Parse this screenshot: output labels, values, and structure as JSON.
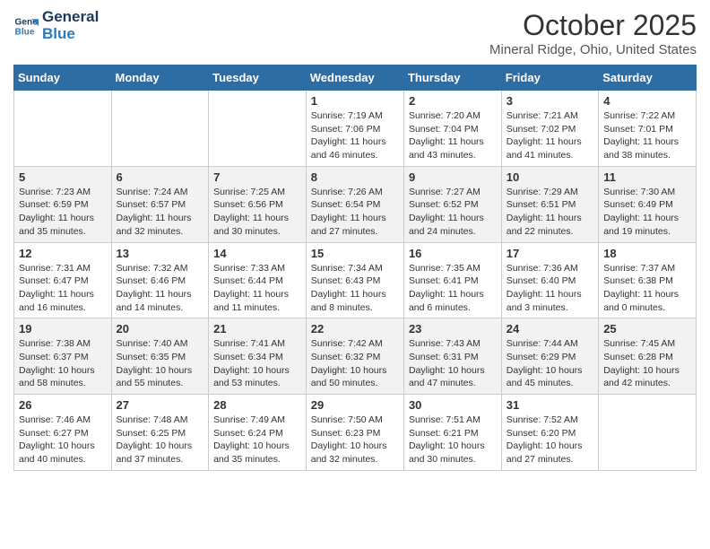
{
  "header": {
    "logo_line1": "General",
    "logo_line2": "Blue",
    "month_title": "October 2025",
    "location": "Mineral Ridge, Ohio, United States"
  },
  "weekdays": [
    "Sunday",
    "Monday",
    "Tuesday",
    "Wednesday",
    "Thursday",
    "Friday",
    "Saturday"
  ],
  "weeks": [
    [
      {
        "day": "",
        "info": ""
      },
      {
        "day": "",
        "info": ""
      },
      {
        "day": "",
        "info": ""
      },
      {
        "day": "1",
        "info": "Sunrise: 7:19 AM\nSunset: 7:06 PM\nDaylight: 11 hours\nand 46 minutes."
      },
      {
        "day": "2",
        "info": "Sunrise: 7:20 AM\nSunset: 7:04 PM\nDaylight: 11 hours\nand 43 minutes."
      },
      {
        "day": "3",
        "info": "Sunrise: 7:21 AM\nSunset: 7:02 PM\nDaylight: 11 hours\nand 41 minutes."
      },
      {
        "day": "4",
        "info": "Sunrise: 7:22 AM\nSunset: 7:01 PM\nDaylight: 11 hours\nand 38 minutes."
      }
    ],
    [
      {
        "day": "5",
        "info": "Sunrise: 7:23 AM\nSunset: 6:59 PM\nDaylight: 11 hours\nand 35 minutes."
      },
      {
        "day": "6",
        "info": "Sunrise: 7:24 AM\nSunset: 6:57 PM\nDaylight: 11 hours\nand 32 minutes."
      },
      {
        "day": "7",
        "info": "Sunrise: 7:25 AM\nSunset: 6:56 PM\nDaylight: 11 hours\nand 30 minutes."
      },
      {
        "day": "8",
        "info": "Sunrise: 7:26 AM\nSunset: 6:54 PM\nDaylight: 11 hours\nand 27 minutes."
      },
      {
        "day": "9",
        "info": "Sunrise: 7:27 AM\nSunset: 6:52 PM\nDaylight: 11 hours\nand 24 minutes."
      },
      {
        "day": "10",
        "info": "Sunrise: 7:29 AM\nSunset: 6:51 PM\nDaylight: 11 hours\nand 22 minutes."
      },
      {
        "day": "11",
        "info": "Sunrise: 7:30 AM\nSunset: 6:49 PM\nDaylight: 11 hours\nand 19 minutes."
      }
    ],
    [
      {
        "day": "12",
        "info": "Sunrise: 7:31 AM\nSunset: 6:47 PM\nDaylight: 11 hours\nand 16 minutes."
      },
      {
        "day": "13",
        "info": "Sunrise: 7:32 AM\nSunset: 6:46 PM\nDaylight: 11 hours\nand 14 minutes."
      },
      {
        "day": "14",
        "info": "Sunrise: 7:33 AM\nSunset: 6:44 PM\nDaylight: 11 hours\nand 11 minutes."
      },
      {
        "day": "15",
        "info": "Sunrise: 7:34 AM\nSunset: 6:43 PM\nDaylight: 11 hours\nand 8 minutes."
      },
      {
        "day": "16",
        "info": "Sunrise: 7:35 AM\nSunset: 6:41 PM\nDaylight: 11 hours\nand 6 minutes."
      },
      {
        "day": "17",
        "info": "Sunrise: 7:36 AM\nSunset: 6:40 PM\nDaylight: 11 hours\nand 3 minutes."
      },
      {
        "day": "18",
        "info": "Sunrise: 7:37 AM\nSunset: 6:38 PM\nDaylight: 11 hours\nand 0 minutes."
      }
    ],
    [
      {
        "day": "19",
        "info": "Sunrise: 7:38 AM\nSunset: 6:37 PM\nDaylight: 10 hours\nand 58 minutes."
      },
      {
        "day": "20",
        "info": "Sunrise: 7:40 AM\nSunset: 6:35 PM\nDaylight: 10 hours\nand 55 minutes."
      },
      {
        "day": "21",
        "info": "Sunrise: 7:41 AM\nSunset: 6:34 PM\nDaylight: 10 hours\nand 53 minutes."
      },
      {
        "day": "22",
        "info": "Sunrise: 7:42 AM\nSunset: 6:32 PM\nDaylight: 10 hours\nand 50 minutes."
      },
      {
        "day": "23",
        "info": "Sunrise: 7:43 AM\nSunset: 6:31 PM\nDaylight: 10 hours\nand 47 minutes."
      },
      {
        "day": "24",
        "info": "Sunrise: 7:44 AM\nSunset: 6:29 PM\nDaylight: 10 hours\nand 45 minutes."
      },
      {
        "day": "25",
        "info": "Sunrise: 7:45 AM\nSunset: 6:28 PM\nDaylight: 10 hours\nand 42 minutes."
      }
    ],
    [
      {
        "day": "26",
        "info": "Sunrise: 7:46 AM\nSunset: 6:27 PM\nDaylight: 10 hours\nand 40 minutes."
      },
      {
        "day": "27",
        "info": "Sunrise: 7:48 AM\nSunset: 6:25 PM\nDaylight: 10 hours\nand 37 minutes."
      },
      {
        "day": "28",
        "info": "Sunrise: 7:49 AM\nSunset: 6:24 PM\nDaylight: 10 hours\nand 35 minutes."
      },
      {
        "day": "29",
        "info": "Sunrise: 7:50 AM\nSunset: 6:23 PM\nDaylight: 10 hours\nand 32 minutes."
      },
      {
        "day": "30",
        "info": "Sunrise: 7:51 AM\nSunset: 6:21 PM\nDaylight: 10 hours\nand 30 minutes."
      },
      {
        "day": "31",
        "info": "Sunrise: 7:52 AM\nSunset: 6:20 PM\nDaylight: 10 hours\nand 27 minutes."
      },
      {
        "day": "",
        "info": ""
      }
    ]
  ]
}
